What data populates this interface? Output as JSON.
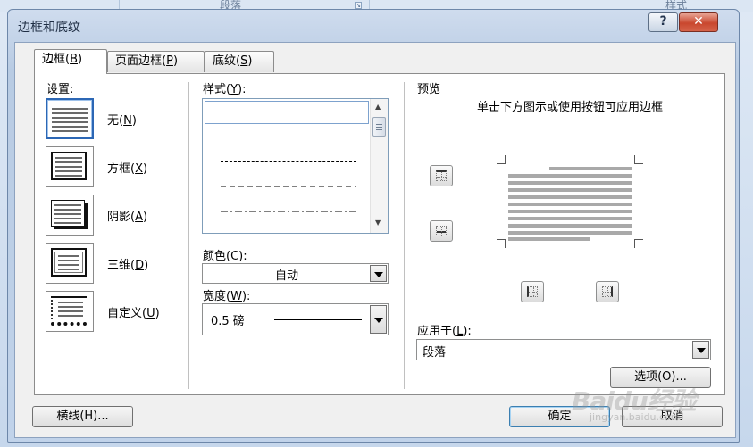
{
  "window": {
    "title": "边框和底纹",
    "help_glyph": "?",
    "close_glyph": "✕"
  },
  "ribbon": {
    "paragraph": "段落",
    "styles": "样式"
  },
  "tabs": [
    {
      "label": "边框",
      "key": "B"
    },
    {
      "label": "页面边框",
      "key": "P"
    },
    {
      "label": "底纹",
      "key": "S"
    }
  ],
  "settings": {
    "label": "设置",
    "key": "",
    "items": [
      {
        "label": "无",
        "key": "N"
      },
      {
        "label": "方框",
        "key": "X"
      },
      {
        "label": "阴影",
        "key": "A"
      },
      {
        "label": "三维",
        "key": "D"
      },
      {
        "label": "自定义",
        "key": "U"
      }
    ]
  },
  "style": {
    "label": "样式",
    "key": "Y"
  },
  "color": {
    "label": "颜色",
    "key": "C",
    "value": "自动"
  },
  "width": {
    "label": "宽度",
    "key": "W",
    "value": "0.5 磅"
  },
  "preview": {
    "label": "预览",
    "hint": "单击下方图示或使用按钮可应用边框"
  },
  "apply_to": {
    "label": "应用于",
    "key": "L",
    "value": "段落"
  },
  "buttons": {
    "options": "选项(O)...",
    "horizontal_line": "横线(H)...",
    "ok": "确定",
    "cancel": "取消"
  },
  "watermark": {
    "text": "Baidu经验",
    "sub": "jingyan.baidu.com"
  },
  "colors": {
    "accent": "#2c67b5",
    "close": "#c9472e"
  }
}
